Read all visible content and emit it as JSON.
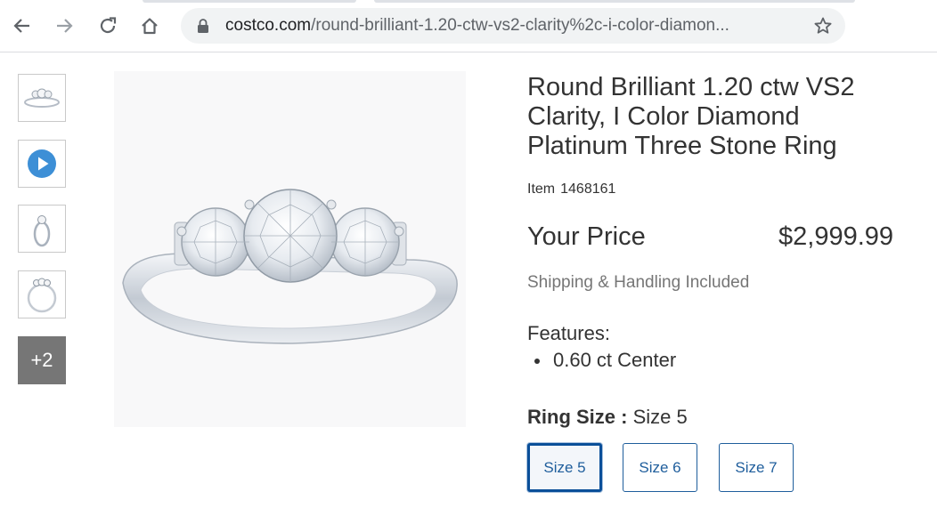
{
  "browser": {
    "url_domain": "costco.com",
    "url_path": "/round-brilliant-1.20-ctw-vs2-clarity%2c-i-color-diamon...",
    "icons": [
      "back-icon",
      "forward-icon",
      "reload-icon",
      "home-icon",
      "lock-icon",
      "bookmark-star-icon"
    ]
  },
  "gallery": {
    "more_label": "+2",
    "thumb_icons": [
      "ring-front-thumb",
      "video-play-icon",
      "ring-angle-thumb",
      "ring-side-thumb"
    ],
    "play_color": "#3d8fd6"
  },
  "product": {
    "title_lines": [
      "Round Brilliant 1.20 ctw VS2",
      "Clarity, I Color Diamond",
      "Platinum Three Stone Ring"
    ],
    "item_label": "Item",
    "item_number": "1468161",
    "price_label": "Your Price",
    "price": "$2,999.99",
    "shipping": "Shipping & Handling Included",
    "features_label": "Features:",
    "features": [
      "0.60 ct Center"
    ],
    "ring_size_label": "Ring Size :",
    "ring_size_value": "Size 5",
    "sizes": [
      "Size 5",
      "Size 6",
      "Size 7"
    ],
    "selected_size": "Size 5",
    "accent_color": "#1f5e9c"
  }
}
